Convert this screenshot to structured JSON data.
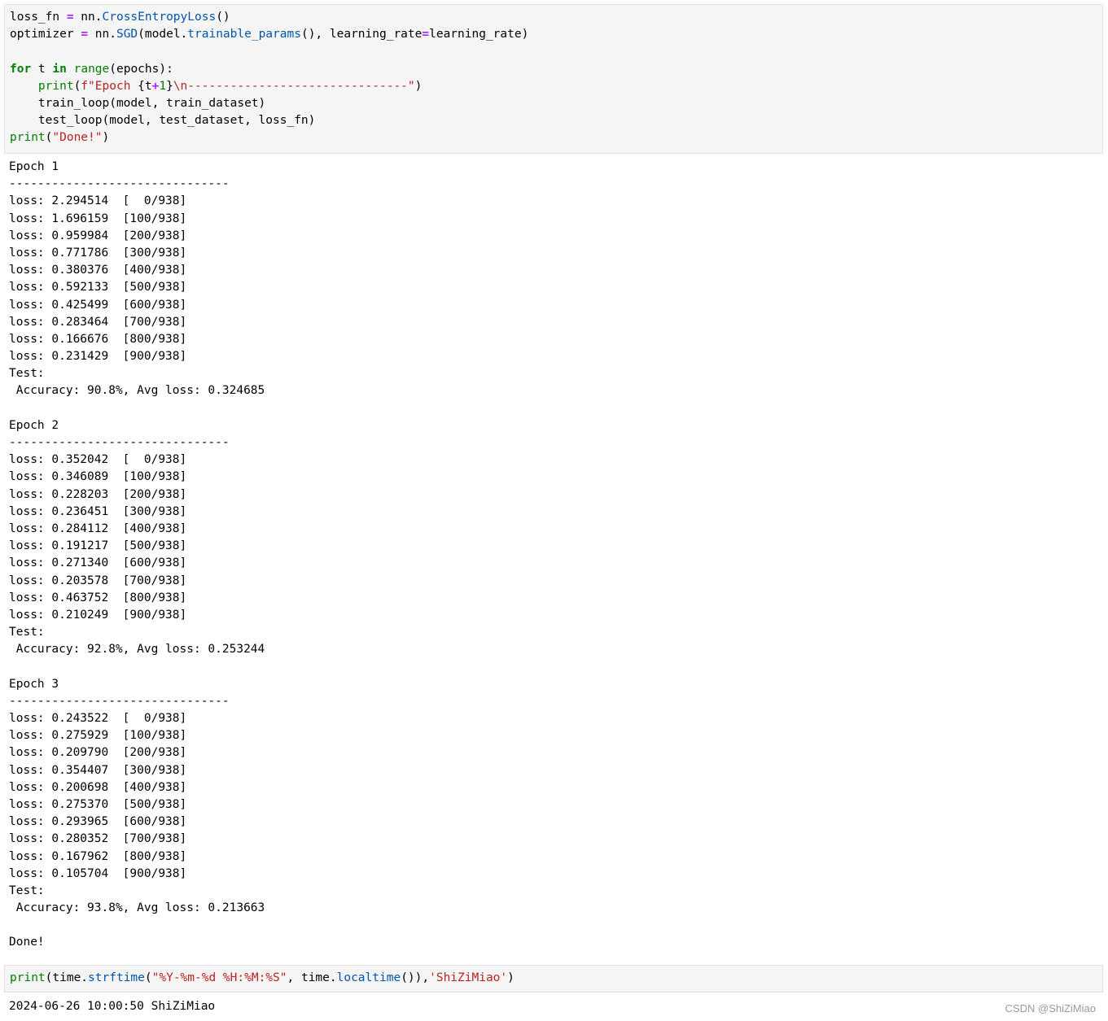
{
  "code_cells": [
    {
      "lines": [
        [
          {
            "t": "loss_fn "
          },
          {
            "t": "=",
            "c": "op"
          },
          {
            "t": " nn."
          },
          {
            "t": "CrossEntropyLoss",
            "c": "fn"
          },
          {
            "t": "()"
          }
        ],
        [
          {
            "t": "optimizer "
          },
          {
            "t": "=",
            "c": "op"
          },
          {
            "t": " nn."
          },
          {
            "t": "SGD",
            "c": "fn"
          },
          {
            "t": "(model."
          },
          {
            "t": "trainable_params",
            "c": "fn"
          },
          {
            "t": "(), learning_rate"
          },
          {
            "t": "=",
            "c": "op"
          },
          {
            "t": "learning_rate)"
          }
        ],
        [],
        [
          {
            "t": "for",
            "c": "kw"
          },
          {
            "t": " t "
          },
          {
            "t": "in",
            "c": "kw"
          },
          {
            "t": " "
          },
          {
            "t": "range",
            "c": "bi"
          },
          {
            "t": "(epochs):"
          }
        ],
        [
          {
            "t": "    "
          },
          {
            "t": "print",
            "c": "bi"
          },
          {
            "t": "("
          },
          {
            "t": "f\"Epoch ",
            "c": "str"
          },
          {
            "t": "{"
          },
          {
            "t": "t"
          },
          {
            "t": "+",
            "c": "op"
          },
          {
            "t": "1",
            "c": "num"
          },
          {
            "t": "}"
          },
          {
            "t": "\\n-------------------------------\"",
            "c": "str"
          },
          {
            "t": ")"
          }
        ],
        [
          {
            "t": "    train_loop(model, train_dataset)"
          }
        ],
        [
          {
            "t": "    test_loop(model, test_dataset, loss_fn)"
          }
        ],
        [
          {
            "t": "print",
            "c": "bi"
          },
          {
            "t": "("
          },
          {
            "t": "\"Done!\"",
            "c": "str"
          },
          {
            "t": ")"
          }
        ]
      ]
    },
    {
      "lines": [
        [
          {
            "t": "print",
            "c": "bi"
          },
          {
            "t": "(time."
          },
          {
            "t": "strftime",
            "c": "fn"
          },
          {
            "t": "("
          },
          {
            "t": "\"%Y-%m-%d %H:%M:%S\"",
            "c": "str"
          },
          {
            "t": ", time."
          },
          {
            "t": "localtime",
            "c": "fn"
          },
          {
            "t": "()),"
          },
          {
            "t": "'ShiZiMiao'",
            "c": "str"
          },
          {
            "t": ")"
          }
        ]
      ]
    }
  ],
  "outputs": [
    {
      "lines": [
        "Epoch 1",
        "-------------------------------",
        "loss: 2.294514  [  0/938]",
        "loss: 1.696159  [100/938]",
        "loss: 0.959984  [200/938]",
        "loss: 0.771786  [300/938]",
        "loss: 0.380376  [400/938]",
        "loss: 0.592133  [500/938]",
        "loss: 0.425499  [600/938]",
        "loss: 0.283464  [700/938]",
        "loss: 0.166676  [800/938]",
        "loss: 0.231429  [900/938]",
        "Test:",
        " Accuracy: 90.8%, Avg loss: 0.324685",
        "",
        "Epoch 2",
        "-------------------------------",
        "loss: 0.352042  [  0/938]",
        "loss: 0.346089  [100/938]",
        "loss: 0.228203  [200/938]",
        "loss: 0.236451  [300/938]",
        "loss: 0.284112  [400/938]",
        "loss: 0.191217  [500/938]",
        "loss: 0.271340  [600/938]",
        "loss: 0.203578  [700/938]",
        "loss: 0.463752  [800/938]",
        "loss: 0.210249  [900/938]",
        "Test:",
        " Accuracy: 92.8%, Avg loss: 0.253244",
        "",
        "Epoch 3",
        "-------------------------------",
        "loss: 0.243522  [  0/938]",
        "loss: 0.275929  [100/938]",
        "loss: 0.209790  [200/938]",
        "loss: 0.354407  [300/938]",
        "loss: 0.200698  [400/938]",
        "loss: 0.275370  [500/938]",
        "loss: 0.293965  [600/938]",
        "loss: 0.280352  [700/938]",
        "loss: 0.167962  [800/938]",
        "loss: 0.105704  [900/938]",
        "Test:",
        " Accuracy: 93.8%, Avg loss: 0.213663",
        "",
        "Done!"
      ]
    },
    {
      "lines": [
        "2024-06-26 10:00:50 ShiZiMiao"
      ]
    }
  ],
  "watermark": "CSDN @ShiZiMiao"
}
